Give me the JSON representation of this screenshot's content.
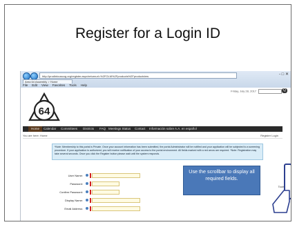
{
  "slide": {
    "title": "Register for a Login ID"
  },
  "browser": {
    "address": "http://prodintouscog.org/register.aspx/returnurl=%2FOLM%2Fproducts%2Fproductview",
    "tab_label": "Area 64 Assembly > Home",
    "window_controls": "- □ ✕",
    "menu": [
      "File",
      "Edit",
      "View",
      "Favorites",
      "Tools",
      "Help"
    ]
  },
  "page": {
    "login_text": "Friday, July 28, 2017",
    "logo_text": "64",
    "nav": [
      "Home",
      "Calendar",
      "Committees",
      "Districts",
      "FAQ",
      "Meetings Status",
      "Contact",
      "Información sobre A.A. en español"
    ],
    "breadcrumb": "You are here: Home",
    "crumb_right": "Register  Login",
    "notice": "*Note: Membership to this portal is Private. Once your account information has been submitted, the portal Administrator will be notified and your application will be subjected to a screening procedure. If your application is authorized, you will receive notification of your access to the portal environment. All fields marked with a red arrow are required. *Note: Registration may take several seconds. Once you click the Register button please wait until the system responds.",
    "form_labels": [
      "User Name:",
      "Password:",
      "Confirm Password:",
      "Display Name:",
      "Email Address:"
    ],
    "right_tools": "Tools"
  },
  "callout": {
    "text": "Use the scrollbar to display all required fields."
  },
  "colors": {
    "callout_fill": "#4a78b8",
    "required_marker": "#d21f1f",
    "nav_bar": "#2a2a2a"
  }
}
